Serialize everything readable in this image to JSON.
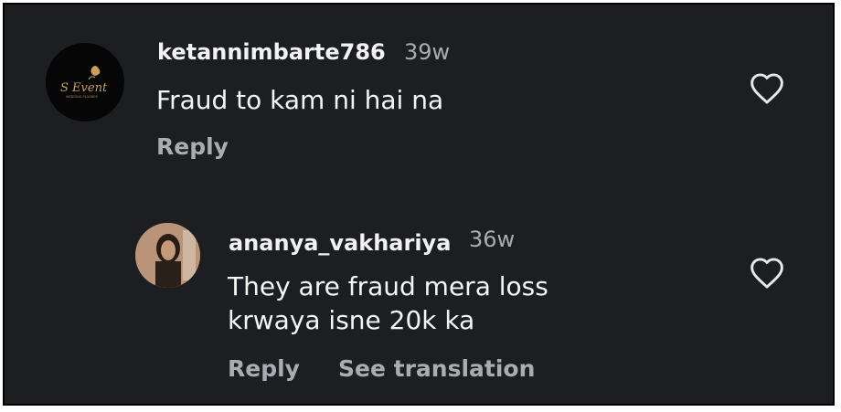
{
  "comments": [
    {
      "username": "ketannimbarte786",
      "time": "39w",
      "text_lines": [
        "Fraud to kam ni hai na"
      ],
      "reply_label": "Reply",
      "avatar": {
        "logo_text": "S Event",
        "logo_subtext": "WEDDING PLANNER"
      }
    },
    {
      "username": "ananya_vakhariya",
      "time": "36w",
      "text_lines": [
        "They are fraud mera loss",
        "krwaya isne 20k ka"
      ],
      "reply_label": "Reply",
      "see_translation_label": "See translation"
    }
  ],
  "icons": {
    "like": "heart-outline-icon"
  },
  "colors": {
    "background": "#1c1e22",
    "primary_text": "#f5f5f5",
    "secondary_text": "#a9acb1"
  }
}
